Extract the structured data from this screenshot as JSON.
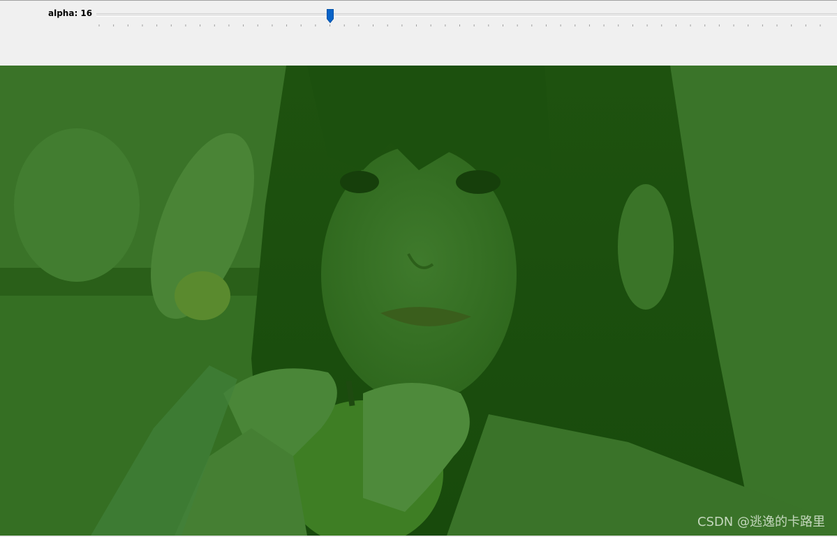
{
  "toolbar": {
    "alpha_label": "alpha: 16",
    "slider": {
      "value": 16,
      "min": 0,
      "max": 50,
      "tick_count": 51,
      "thumb_color": "#0a64c8"
    }
  },
  "image": {
    "description_icon": "photo-canvas",
    "tint_color": "#2d6b1c",
    "watermark": "CSDN @逃逸的卡路里"
  }
}
